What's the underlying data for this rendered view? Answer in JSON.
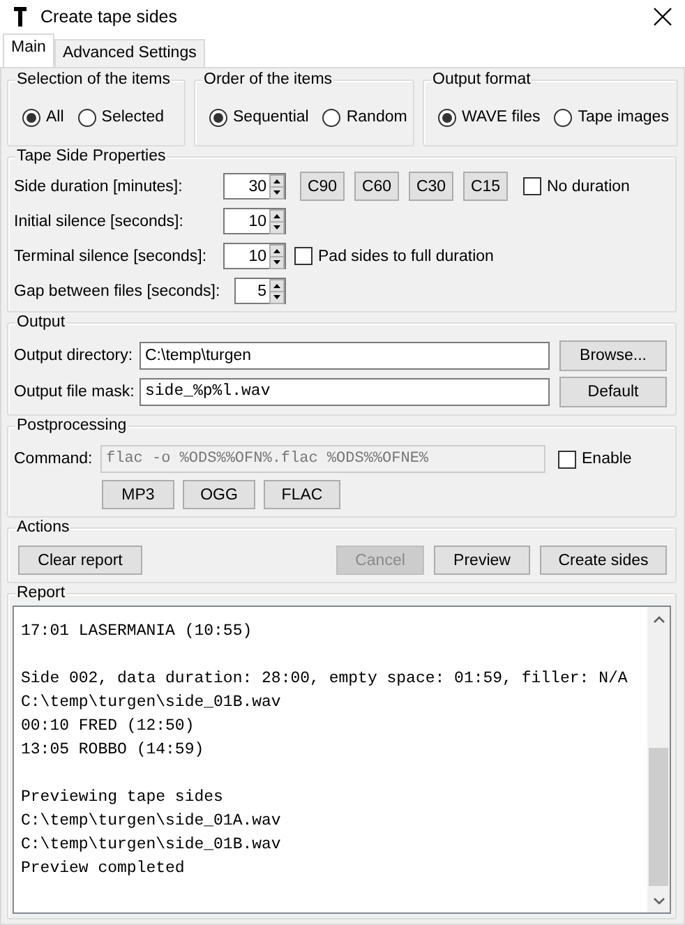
{
  "window": {
    "title": "Create tape sides"
  },
  "tabs": [
    {
      "label": "Main",
      "selected": true
    },
    {
      "label": "Advanced Settings",
      "selected": false
    }
  ],
  "option_groups": [
    {
      "title": "Selection of the items",
      "options": [
        {
          "label": "All",
          "selected": true
        },
        {
          "label": "Selected",
          "selected": false
        }
      ]
    },
    {
      "title": "Order of the items",
      "options": [
        {
          "label": "Sequential",
          "selected": true
        },
        {
          "label": "Random",
          "selected": false
        }
      ]
    },
    {
      "title": "Output format",
      "options": [
        {
          "label": "WAVE files",
          "selected": true
        },
        {
          "label": "Tape images",
          "selected": false
        }
      ]
    }
  ],
  "tape_side_properties": {
    "title": "Tape Side Properties",
    "fields": [
      {
        "label": "Side duration [minutes]:",
        "value": "30",
        "presets": [
          "C90",
          "C60",
          "C30",
          "C15"
        ],
        "checkbox": {
          "label": "No duration",
          "checked": false
        }
      },
      {
        "label": "Initial silence [seconds]:",
        "value": "10"
      },
      {
        "label": "Terminal silence [seconds]:",
        "value": "10",
        "checkbox": {
          "label": "Pad sides to full duration",
          "checked": false
        }
      },
      {
        "label": "Gap between files [seconds]:",
        "value": "5"
      }
    ]
  },
  "output": {
    "title": "Output",
    "rows": [
      {
        "label": "Output directory:",
        "value": "C:\\temp\\turgen",
        "mono": false,
        "button": "Browse..."
      },
      {
        "label": "Output file mask:",
        "value": "side_%p%l.wav",
        "mono": true,
        "button": "Default"
      }
    ]
  },
  "postprocessing": {
    "title": "Postprocessing",
    "command": {
      "label": "Command:",
      "value": "flac -o %ODS%%OFN%.flac %ODS%%OFNE%",
      "disabled": true
    },
    "enable": {
      "label": "Enable",
      "checked": false
    },
    "presets": [
      "MP3",
      "OGG",
      "FLAC"
    ]
  },
  "actions": {
    "title": "Actions",
    "buttons": [
      {
        "label": "Clear report",
        "disabled": false
      },
      {
        "label": "Cancel",
        "disabled": true
      },
      {
        "label": "Preview",
        "disabled": false
      },
      {
        "label": "Create sides",
        "disabled": false
      }
    ]
  },
  "report": {
    "title": "Report",
    "blocks": [
      [
        "17:01 LASERMANIA (10:55)"
      ],
      [
        "Side 002, data duration: 28:00, empty space: 01:59, filler: N/A",
        "C:\\temp\\turgen\\side_01B.wav",
        "00:10 FRED (12:50)",
        "13:05 ROBBO (14:59)"
      ],
      [
        "Previewing tape sides",
        "C:\\temp\\turgen\\side_01A.wav",
        "C:\\temp\\turgen\\side_01B.wav",
        "Preview completed"
      ]
    ]
  }
}
